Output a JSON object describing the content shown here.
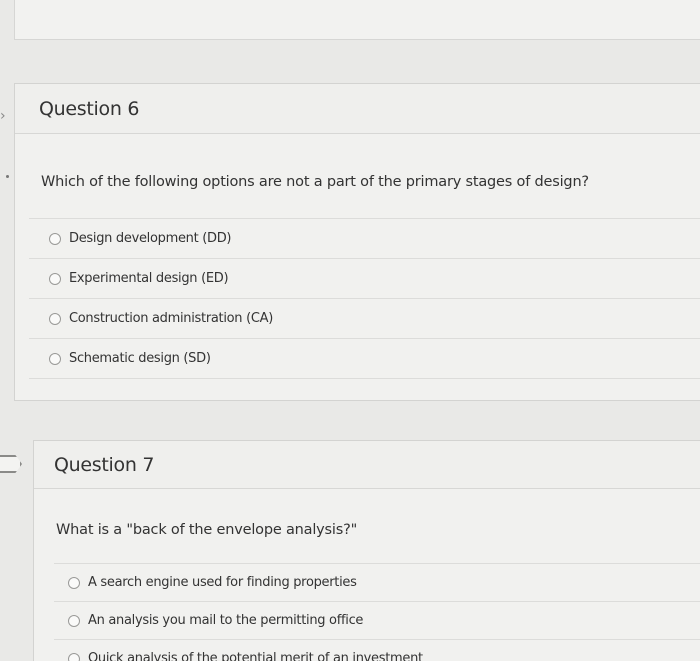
{
  "questions": [
    {
      "title": "Question 6",
      "prompt": "Which of the following options are not a part of the primary stages of design?",
      "options": [
        "Design development (DD)",
        "Experimental design (ED)",
        "Construction administration (CA)",
        "Schematic design (SD)"
      ]
    },
    {
      "title": "Question 7",
      "prompt": "What is a \"back of the envelope analysis?\"",
      "options": [
        "A search engine used for finding properties",
        "An analysis you mail to the permitting office",
        "Quick analysis of the potential merit of an investment"
      ]
    }
  ],
  "icons": {
    "flag_q6": "chevron-right-icon",
    "flag_q7": "flag-icon"
  }
}
